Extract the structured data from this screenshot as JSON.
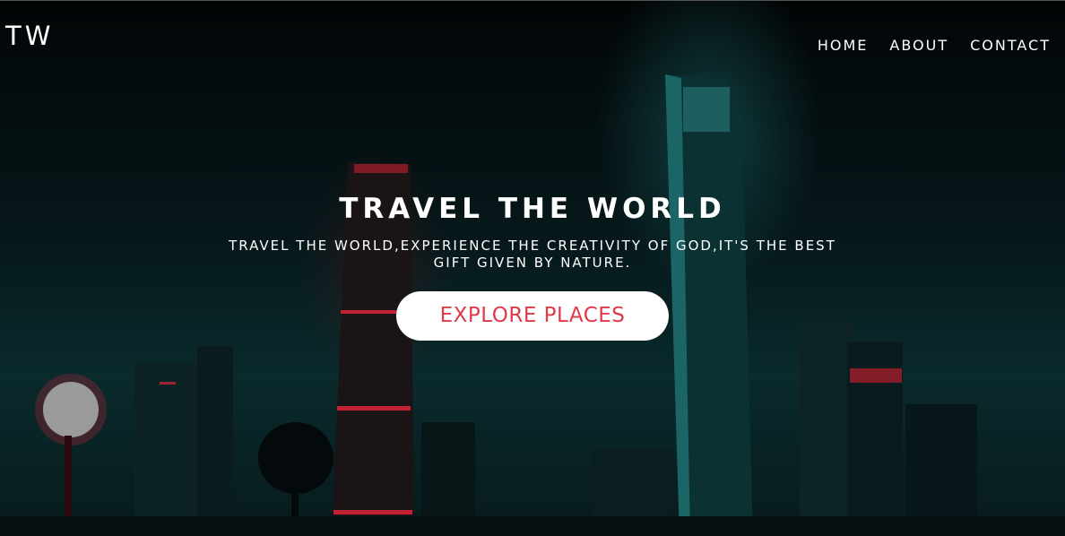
{
  "brand": {
    "logo_text": "TW"
  },
  "nav": {
    "items": [
      {
        "label": "HOME"
      },
      {
        "label": "ABOUT"
      },
      {
        "label": "CONTACT"
      }
    ]
  },
  "hero": {
    "title": "TRAVEL THE WORLD",
    "subtitle": "TRAVEL THE WORLD,EXPERIENCE THE CREATIVITY OF GOD,IT'S THE BEST GIFT GIVEN BY NATURE.",
    "cta_label": "EXPLORE PLACES",
    "cta_text_color": "#e03a49",
    "cta_background": "#ffffff"
  },
  "background": {
    "description_colors": {
      "teal": "#1f8c8f",
      "red": "#e0253a"
    }
  }
}
